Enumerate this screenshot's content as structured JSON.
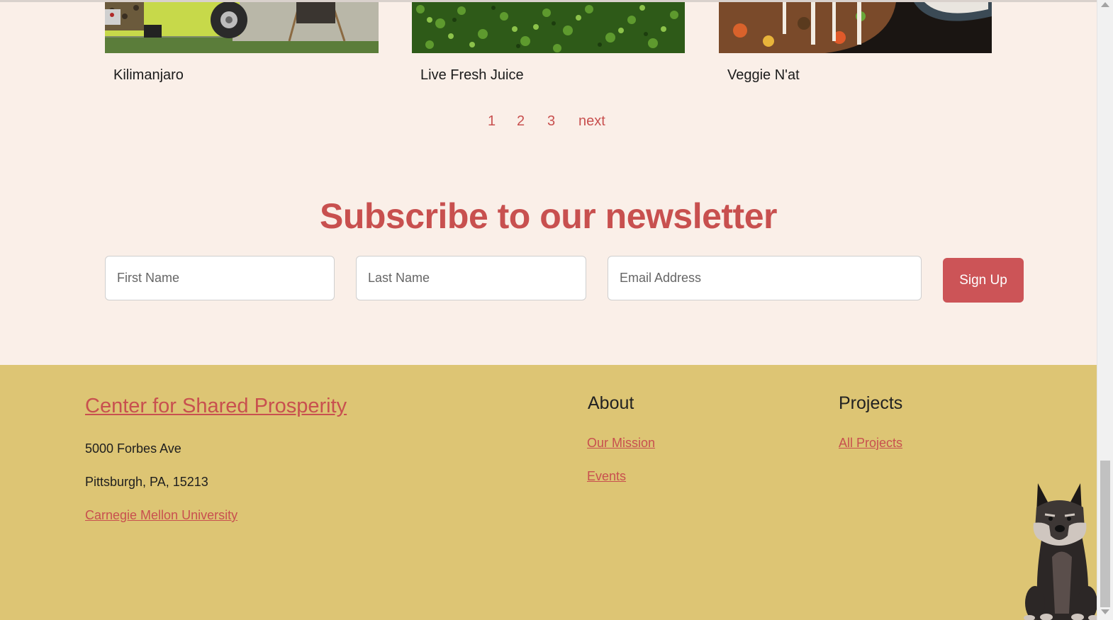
{
  "cards": [
    {
      "title": "Kilimanjaro"
    },
    {
      "title": "Live Fresh Juice"
    },
    {
      "title": "Veggie N'at"
    }
  ],
  "pagination": {
    "pages": [
      "1",
      "2",
      "3"
    ],
    "next": "next"
  },
  "newsletter": {
    "title": "Subscribe to our newsletter",
    "first_name_placeholder": "First Name",
    "last_name_placeholder": "Last Name",
    "email_placeholder": "Email Address",
    "signup_label": "Sign Up"
  },
  "footer": {
    "org_name": "Center for Shared Prosperity",
    "address_line1": "5000 Forbes Ave",
    "address_line2": "Pittsburgh, PA, 15213",
    "university": "Carnegie Mellon University",
    "about": {
      "heading": "About",
      "links": [
        "Our Mission",
        "Events"
      ]
    },
    "projects": {
      "heading": "Projects",
      "links": [
        "All Projects"
      ]
    }
  },
  "colors": {
    "page_bg": "#faefe8",
    "accent": "#c8504f",
    "footer_bg": "#ddc574",
    "button_bg": "#cc5457"
  },
  "icons": {
    "mascot": "dog-mascot-icon"
  }
}
